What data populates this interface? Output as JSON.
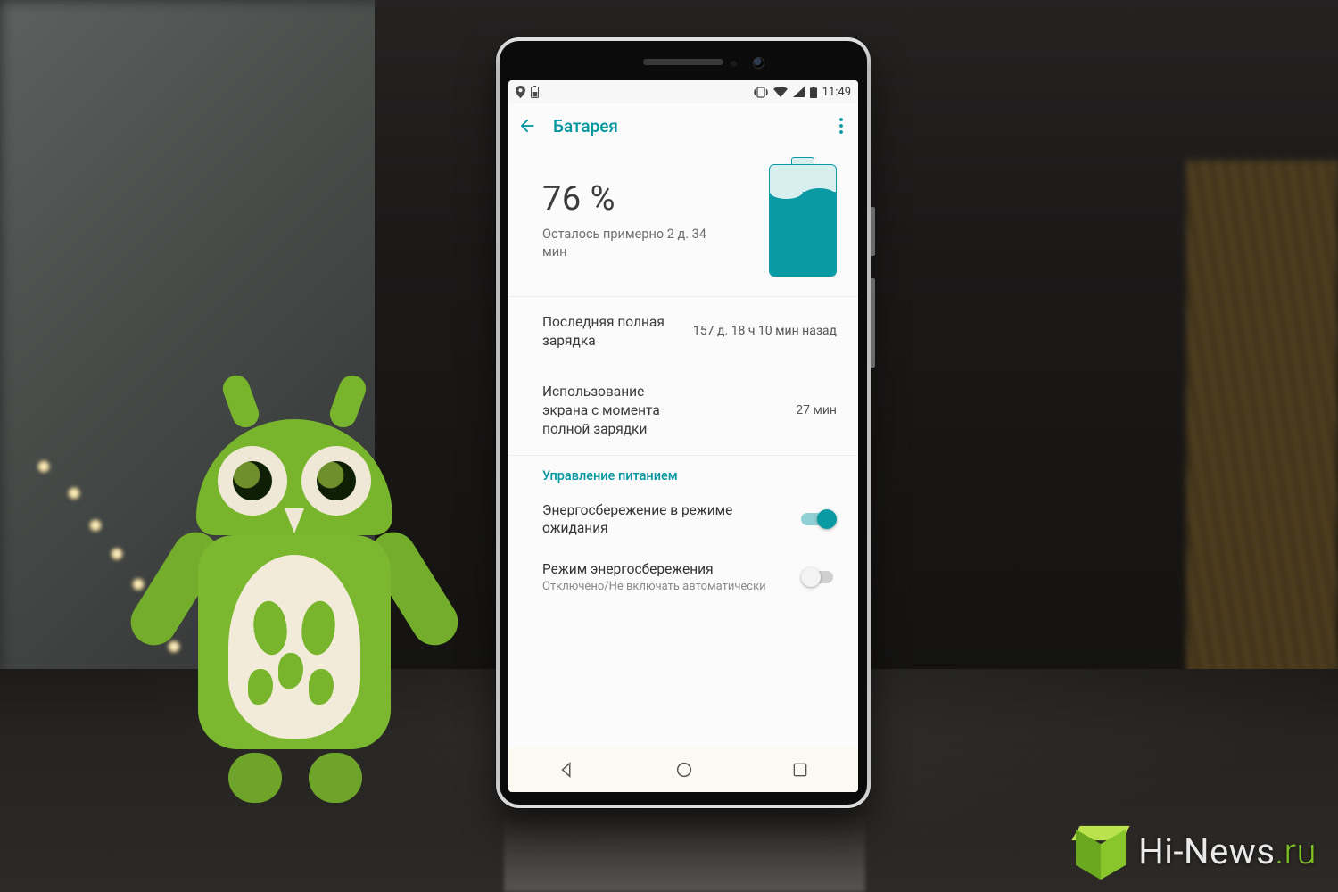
{
  "statusbar": {
    "time": "11:49"
  },
  "appbar": {
    "title": "Батарея"
  },
  "hero": {
    "percent": "76 %",
    "remaining": "Осталось примерно 2 д. 34 мин"
  },
  "rows": {
    "last_full_label": "Последняя полная зарядка",
    "last_full_value": "157 д. 18 ч 10 мин назад",
    "screen_use_label": "Использование экрана с момента полной зарядки",
    "screen_use_value": "27 мин"
  },
  "section": {
    "power_management": "Управление питанием"
  },
  "settings": {
    "standby_saver": {
      "title": "Энергосбережение в режиме ожидания"
    },
    "battery_saver": {
      "title": "Режим энергосбережения",
      "subtitle": "Отключено/Не включать автоматически"
    }
  },
  "watermark": {
    "brand": "Hi-News",
    "tld": ".ru"
  }
}
